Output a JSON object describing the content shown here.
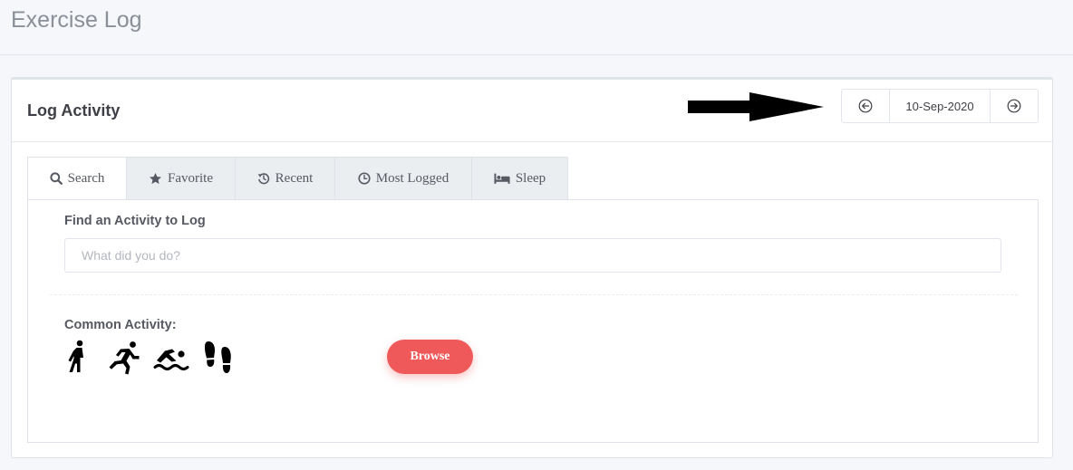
{
  "page": {
    "title": "Exercise Log"
  },
  "card": {
    "title": "Log Activity"
  },
  "date_nav": {
    "date": "10-Sep-2020",
    "prev_icon": "circle-arrow-left-icon",
    "next_icon": "circle-arrow-right-icon"
  },
  "tabs": [
    {
      "label": "Search",
      "icon": "search-icon",
      "active": true
    },
    {
      "label": "Favorite",
      "icon": "star-icon",
      "active": false
    },
    {
      "label": "Recent",
      "icon": "history-icon",
      "active": false
    },
    {
      "label": "Most Logged",
      "icon": "clock-icon",
      "active": false
    },
    {
      "label": "Sleep",
      "icon": "bed-icon",
      "active": false
    }
  ],
  "search": {
    "label": "Find an Activity to Log",
    "placeholder": "What did you do?",
    "value": ""
  },
  "common": {
    "label": "Common Activity:",
    "activities": [
      "walking-icon",
      "running-icon",
      "swimming-icon",
      "footprints-icon"
    ]
  },
  "browse": {
    "label": "Browse"
  },
  "colors": {
    "accent": "#f0595a",
    "text": "#3f4047",
    "muted": "#8b8f97"
  }
}
